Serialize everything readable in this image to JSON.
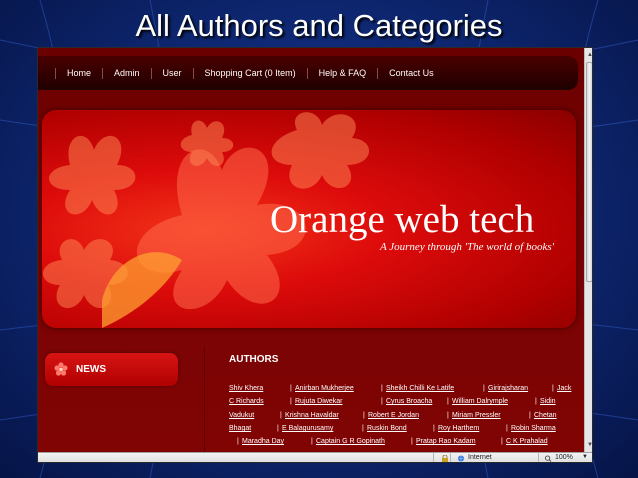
{
  "slide": {
    "title": "All Authors and Categories"
  },
  "site": {
    "nav": [
      {
        "label": "Home"
      },
      {
        "label": "Admin"
      },
      {
        "label": "User"
      },
      {
        "label": "Shopping Cart (0 Item)"
      },
      {
        "label": "Help & FAQ"
      },
      {
        "label": "Contact Us"
      }
    ],
    "banner": {
      "title": "Orange web tech",
      "tagline": "A Journey through 'The world of books'"
    },
    "news": {
      "label": "NEWS"
    },
    "authors": {
      "heading": "AUTHORS",
      "rows": [
        [
          "Shiv Khera",
          "Anirban Mukherjee",
          "Sheikh Chilli Ke Latife",
          "Girirajsharan",
          "Jack"
        ],
        [
          "C Richards",
          "Rujuta Diwekar",
          "Cyrus Broacha",
          "William Dalrymple",
          "Sidin"
        ],
        [
          "Vadukut",
          "Krishna Havaldar",
          "Robert E Jordan",
          "Miriam Pressler",
          "Chetan"
        ],
        [
          "Bhagat",
          "E Balagurusamy",
          "Ruskin Bond",
          "Roy Harthem",
          "Robin Sharma"
        ],
        [
          "Maradha Day",
          "Captain G R Gopinath",
          "Pratap Rao Kadam",
          "C K Prahalad"
        ]
      ]
    }
  },
  "browser": {
    "status_zone": "Internet",
    "status_zoom": "100%"
  },
  "colors": {
    "slide_bg": "#0f2a78",
    "site_bg": "#760303",
    "banner_red": "#dd0b0b",
    "text_white": "#ffffff"
  }
}
